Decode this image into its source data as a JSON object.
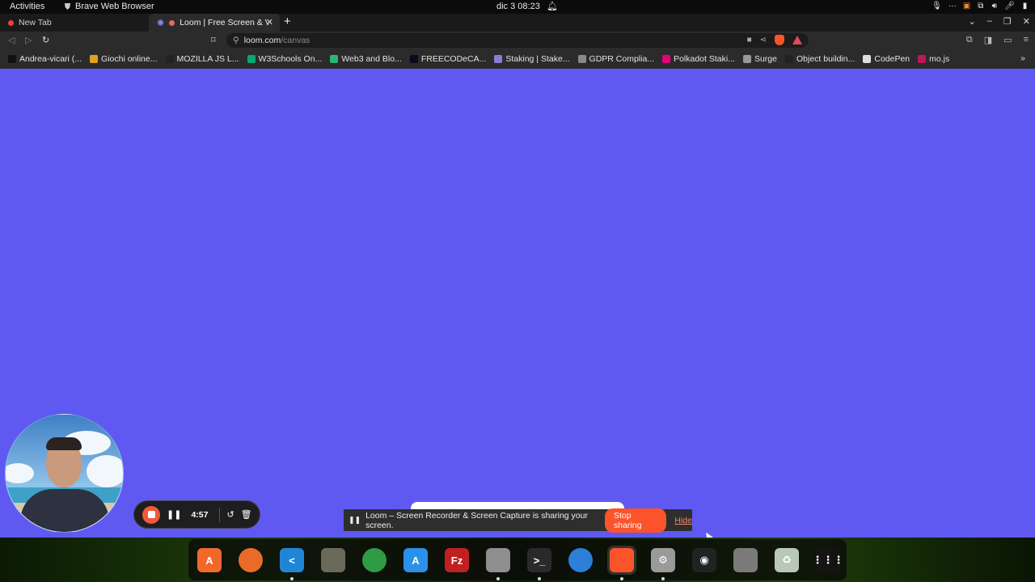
{
  "topbar": {
    "activities": "Activities",
    "app_name": "Brave Web Browser",
    "clock": "dic 3  08:23"
  },
  "tabs": [
    {
      "title": "New Tab"
    },
    {
      "title": "Loom | Free Screen & V"
    }
  ],
  "address": {
    "host": "loom.com",
    "path": "/canvas"
  },
  "bookmarks": [
    {
      "label": "Andrea-vicari (...",
      "icon": "github-icon",
      "color": "#111111"
    },
    {
      "label": "Giochi online...",
      "icon": "games-icon",
      "color": "#e0a020"
    },
    {
      "label": "MOZILLA JS L...",
      "icon": "mdn-icon",
      "color": "#222222"
    },
    {
      "label": "W3Schools On...",
      "icon": "w3schools-icon",
      "color": "#04aa6d"
    },
    {
      "label": "Web3 and Blo...",
      "icon": "web3-icon",
      "color": "#2bb673"
    },
    {
      "label": "FREECODeCA...",
      "icon": "freecodecamp-icon",
      "color": "#0a0a23"
    },
    {
      "label": "Staking | Stake...",
      "icon": "ethereum-icon",
      "color": "#8a7dd8"
    },
    {
      "label": "GDPR Complia...",
      "icon": "globe-icon",
      "color": "#888888"
    },
    {
      "label": "Polkadot Staki...",
      "icon": "polkadot-icon",
      "color": "#e6007a"
    },
    {
      "label": "Surge",
      "icon": "surge-icon",
      "color": "#999999"
    },
    {
      "label": "Object buildin...",
      "icon": "mdn-icon",
      "color": "#222222"
    },
    {
      "label": "CodePen",
      "icon": "codepen-icon",
      "color": "#dddddd"
    },
    {
      "label": "mo.js",
      "icon": "mojs-icon",
      "color": "#c0145c"
    }
  ],
  "recorder": {
    "time": "4:57"
  },
  "share_bar": {
    "message": "Loom – Screen Recorder & Screen Capture is sharing your screen.",
    "stop_label": "Stop sharing",
    "hide_label": "Hide"
  },
  "colors": {
    "page_background": "#6059f1",
    "loom_accent": "#fb542b"
  },
  "dock": [
    {
      "name": "app-center-icon",
      "color": "#f0682a",
      "glyph": "A",
      "running": false
    },
    {
      "name": "firefox-icon",
      "color": "#e96b2a",
      "glyph": "",
      "running": false
    },
    {
      "name": "vscode-icon",
      "color": "#1f86d6",
      "glyph": "<",
      "running": true
    },
    {
      "name": "gimp-icon",
      "color": "#6a6a5a",
      "glyph": "",
      "running": false
    },
    {
      "name": "chrome-icon",
      "color": "#2e9b46",
      "glyph": "",
      "running": false
    },
    {
      "name": "appstore-icon",
      "color": "#2b90e8",
      "glyph": "A",
      "running": false
    },
    {
      "name": "filezilla-icon",
      "color": "#c02020",
      "glyph": "Fz",
      "running": false
    },
    {
      "name": "files-icon",
      "color": "#8e8e8e",
      "glyph": "",
      "running": true
    },
    {
      "name": "terminal-icon",
      "color": "#2a2a2a",
      "glyph": ">_",
      "running": true
    },
    {
      "name": "thunderbird-icon",
      "color": "#2e7fd8",
      "glyph": "",
      "running": false
    },
    {
      "name": "brave-icon",
      "color": "#fb542b",
      "glyph": "",
      "running": true,
      "active": true
    },
    {
      "name": "settings-icon",
      "color": "#9a9a9a",
      "glyph": "⚙",
      "running": true
    },
    {
      "name": "screenshot-icon",
      "color": "#222222",
      "glyph": "◉",
      "running": false
    },
    {
      "name": "device-icon",
      "color": "#7a7a7a",
      "glyph": "",
      "running": false
    },
    {
      "name": "trash-icon",
      "color": "#b8c8b8",
      "glyph": "♻",
      "running": false
    },
    {
      "name": "app-grid-icon",
      "color": "#141414",
      "glyph": "⋮⋮⋮",
      "running": false
    }
  ]
}
